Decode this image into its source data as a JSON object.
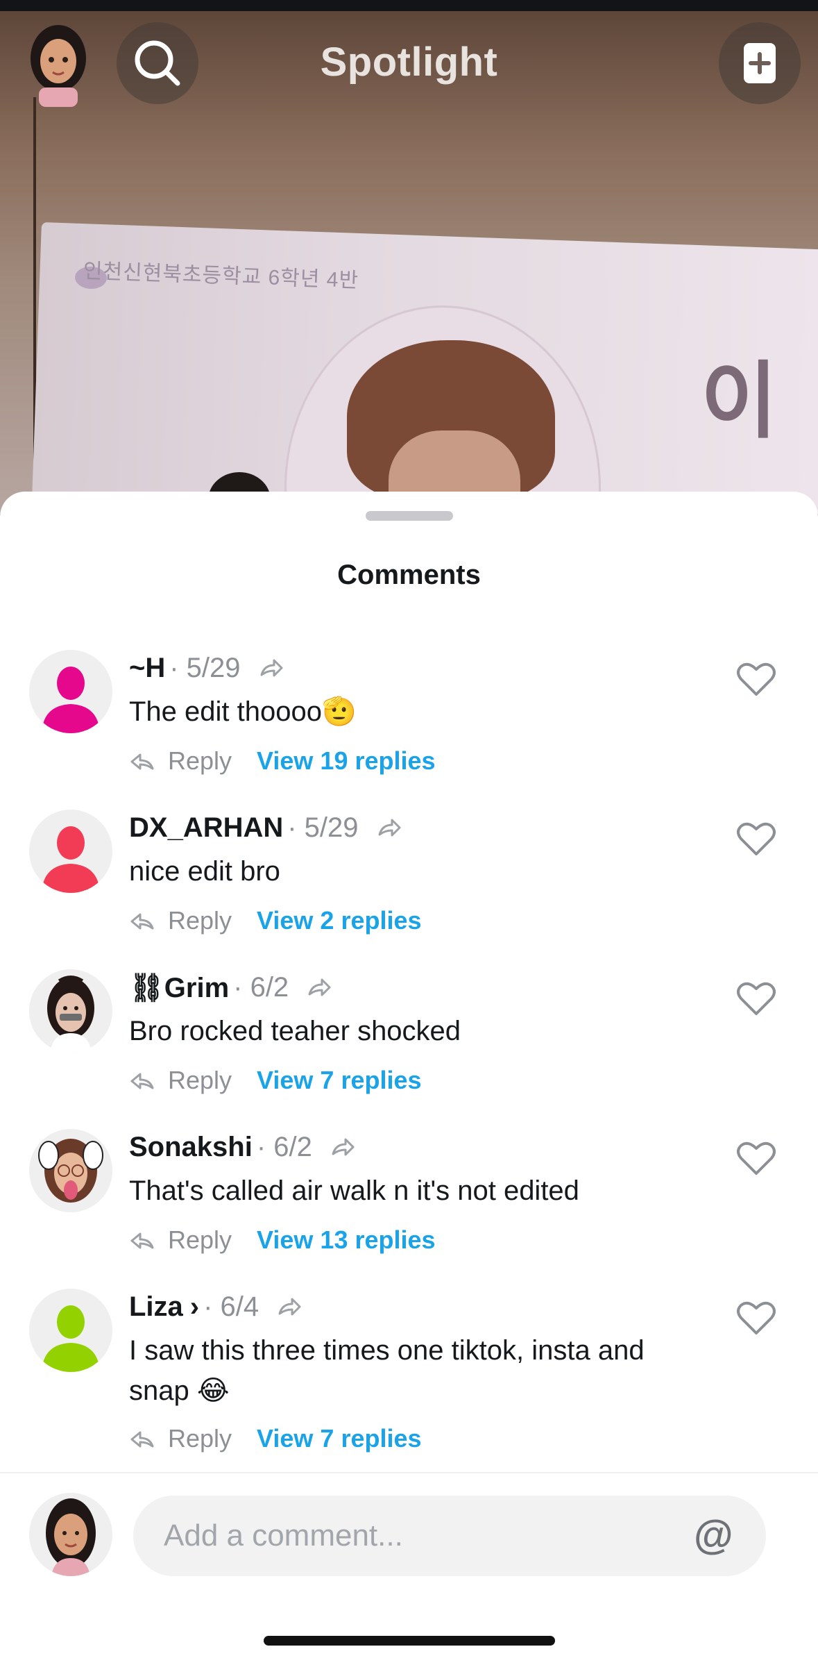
{
  "header": {
    "title": "Spotlight",
    "search_icon": "search-icon",
    "add_icon": "add-story-icon"
  },
  "video": {
    "banner_text": "인천신현북초등학교 6학년 4반",
    "big_text": "이"
  },
  "comments_sheet": {
    "title": "Comments",
    "items": [
      {
        "name": "~H",
        "date": "· 5/29",
        "text": "The edit thoooo🫡",
        "reply_label": "Reply",
        "view_replies": "View 19 replies",
        "avatar_color": "#e5088d",
        "avatar_type": "silhouette"
      },
      {
        "name": "DX_ARHAN",
        "date": "· 5/29",
        "text": "nice edit bro",
        "reply_label": "Reply",
        "view_replies": "View 2 replies",
        "avatar_color": "#f23b55",
        "avatar_type": "silhouette"
      },
      {
        "name": "⛓Grim",
        "date": "· 6/2",
        "text": "Bro rocked teaher shocked",
        "reply_label": "Reply",
        "view_replies": "View 7 replies",
        "avatar_color": "#2a1d1a",
        "avatar_type": "bitmoji"
      },
      {
        "name": "Sonakshi",
        "date": "· 6/2",
        "text": "That's called air walk  n it's not edited",
        "reply_label": "Reply",
        "view_replies": "View 13 replies",
        "avatar_color": "#6b3b2a",
        "avatar_type": "bitmoji"
      },
      {
        "name": "Liza",
        "chevron": "›",
        "date": "· 6/4",
        "text": "I saw this three times one tiktok, insta and snap 😂",
        "reply_label": "Reply",
        "view_replies": "View 7 replies",
        "avatar_color": "#94d100",
        "avatar_type": "silhouette"
      }
    ]
  },
  "composer": {
    "placeholder": "Add a comment...",
    "mention_symbol": "@"
  }
}
